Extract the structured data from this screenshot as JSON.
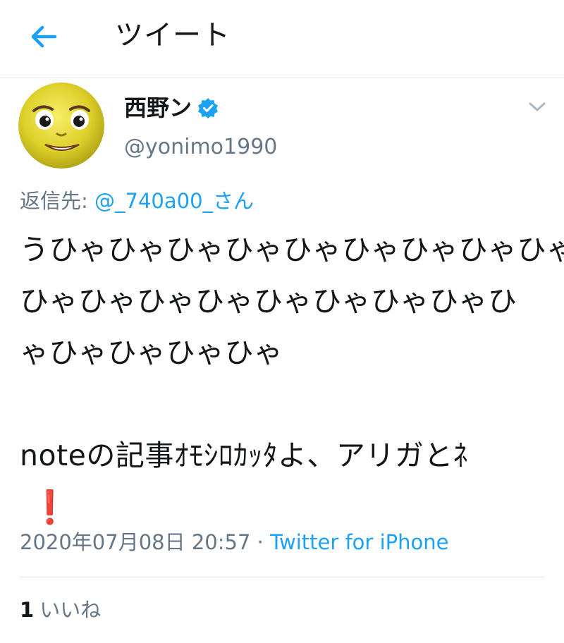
{
  "header": {
    "title": "ツイート",
    "back_icon": "arrow-left-icon"
  },
  "author": {
    "display_name": "西野ン",
    "handle": "@yonimo1990",
    "verified": true,
    "avatar_icon": "yellow-face-avatar"
  },
  "reply": {
    "prefix": "返信先: ",
    "mention": "@_740a00_さん"
  },
  "tweet": {
    "lines": [
      "うひゃひゃひゃひゃひゃひゃひゃひゃひゃ",
      "ひゃひゃひゃひゃひゃひゃひゃひゃひ",
      "ゃひゃひゃひゃひゃ",
      "",
      "noteの記事ｵﾓｼﾛｶｯﾀよ、アリガとﾈ"
    ],
    "emoji": "❗"
  },
  "meta": {
    "timestamp": "2020年07月08日 20:57",
    "separator": " · ",
    "source": "Twitter for iPhone"
  },
  "engagement": {
    "likes_count": "1",
    "likes_label": "いいね"
  },
  "colors": {
    "accent": "#1da1f2",
    "secondary_text": "#657786",
    "primary_text": "#14171a",
    "divider": "#e1e8ed"
  }
}
